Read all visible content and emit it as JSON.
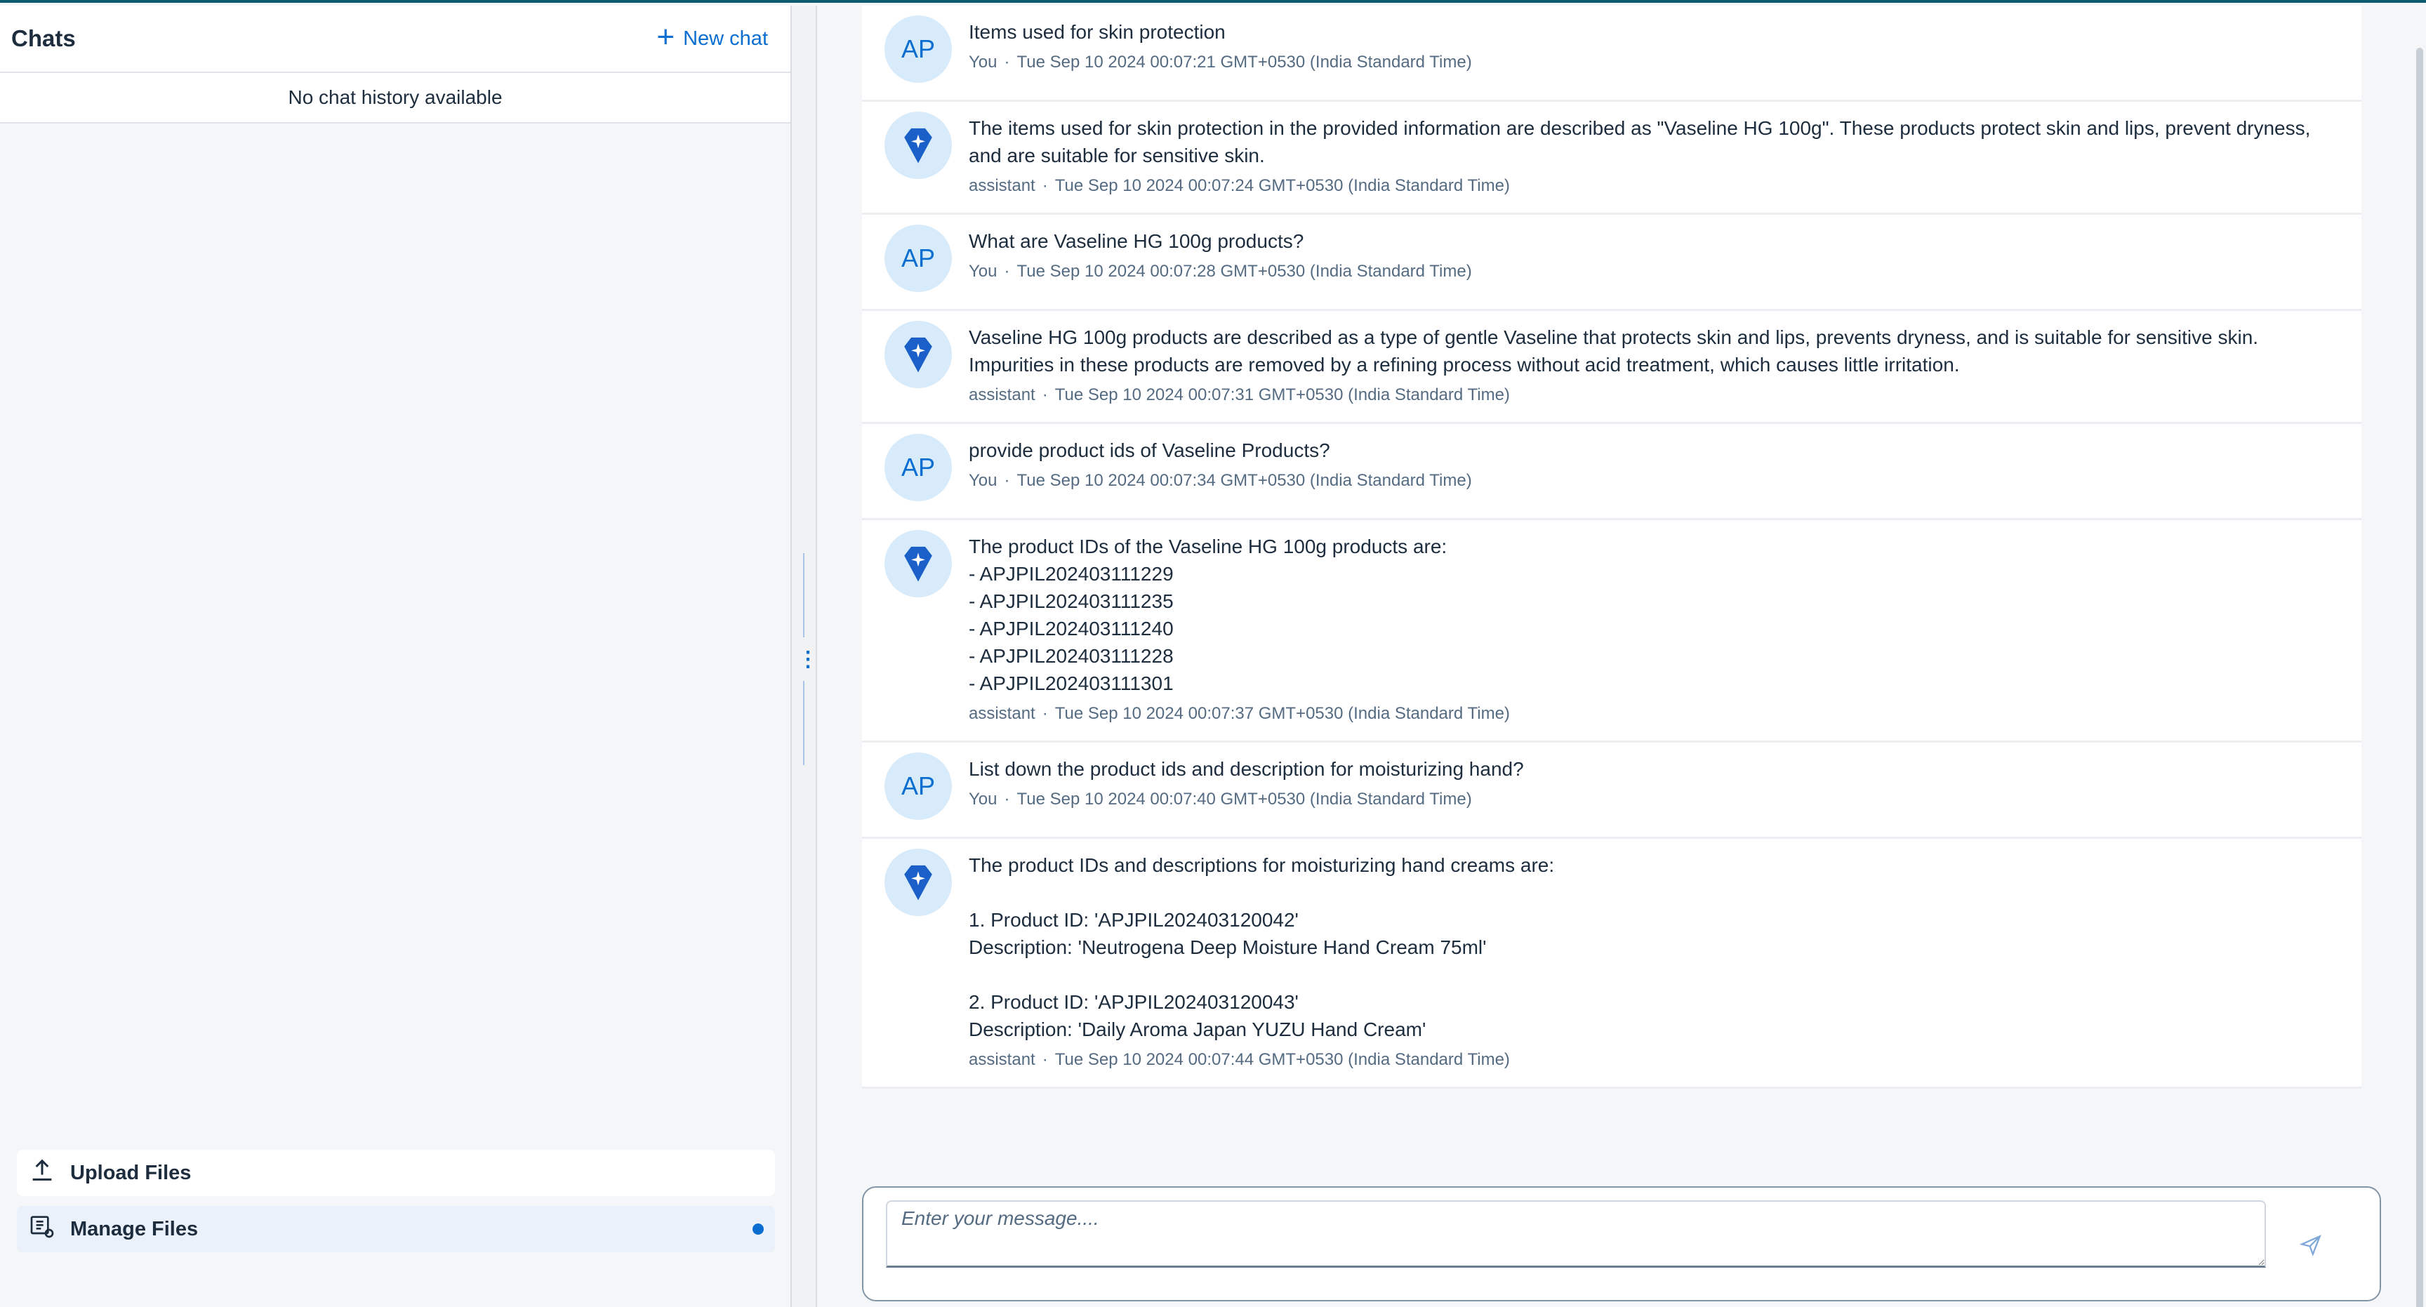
{
  "sidebar": {
    "title": "Chats",
    "new_chat_label": "New chat",
    "empty_text": "No chat history available",
    "upload_label": "Upload Files",
    "manage_label": "Manage Files"
  },
  "messages": [
    {
      "role": "user",
      "avatar": "AP",
      "text": "Items used for skin protection",
      "sender": "You",
      "time": "Tue Sep 10 2024 00:07:21 GMT+0530 (India Standard Time)"
    },
    {
      "role": "assistant",
      "avatar_icon": "diamond-sparkle-icon",
      "text": "The items used for skin protection in the provided information are described as \"Vaseline HG 100g\". These products protect skin and lips, prevent dryness, and are suitable for sensitive skin.",
      "sender": "assistant",
      "time": "Tue Sep 10 2024 00:07:24 GMT+0530 (India Standard Time)"
    },
    {
      "role": "user",
      "avatar": "AP",
      "text": "What are Vaseline HG 100g products?",
      "sender": "You",
      "time": "Tue Sep 10 2024 00:07:28 GMT+0530 (India Standard Time)"
    },
    {
      "role": "assistant",
      "avatar_icon": "diamond-sparkle-icon",
      "text": "Vaseline HG 100g products are described as a type of gentle Vaseline that protects skin and lips, prevents dryness, and is suitable for sensitive skin. Impurities in these products are removed by a refining process without acid treatment, which causes little irritation.",
      "sender": "assistant",
      "time": "Tue Sep 10 2024 00:07:31 GMT+0530 (India Standard Time)"
    },
    {
      "role": "user",
      "avatar": "AP",
      "text": "provide product ids of Vaseline Products?",
      "sender": "You",
      "time": "Tue Sep 10 2024 00:07:34 GMT+0530 (India Standard Time)"
    },
    {
      "role": "assistant",
      "avatar_icon": "diamond-sparkle-icon",
      "text": "The product IDs of the Vaseline HG 100g products are:\n- APJPIL202403111229\n- APJPIL202403111235\n- APJPIL202403111240\n- APJPIL202403111228\n- APJPIL202403111301",
      "sender": "assistant",
      "time": "Tue Sep 10 2024 00:07:37 GMT+0530 (India Standard Time)"
    },
    {
      "role": "user",
      "avatar": "AP",
      "text": "List down the product ids and description for moisturizing hand?",
      "sender": "You",
      "time": "Tue Sep 10 2024 00:07:40 GMT+0530 (India Standard Time)"
    },
    {
      "role": "assistant",
      "avatar_icon": "diamond-sparkle-icon",
      "text": "The product IDs and descriptions for moisturizing hand creams are:\n\n1. Product ID: 'APJPIL202403120042'\nDescription: 'Neutrogena Deep Moisture Hand Cream 75ml'\n\n2. Product ID: 'APJPIL202403120043'\nDescription: 'Daily Aroma Japan YUZU Hand Cream'",
      "sender": "assistant",
      "time": "Tue Sep 10 2024 00:07:44 GMT+0530 (India Standard Time)"
    }
  ],
  "composer": {
    "placeholder": "Enter your message...."
  },
  "colors": {
    "accent": "#0a6ed1",
    "avatar_bg": "#d8ebfb",
    "assistant_icon": "#1b5fc8"
  }
}
